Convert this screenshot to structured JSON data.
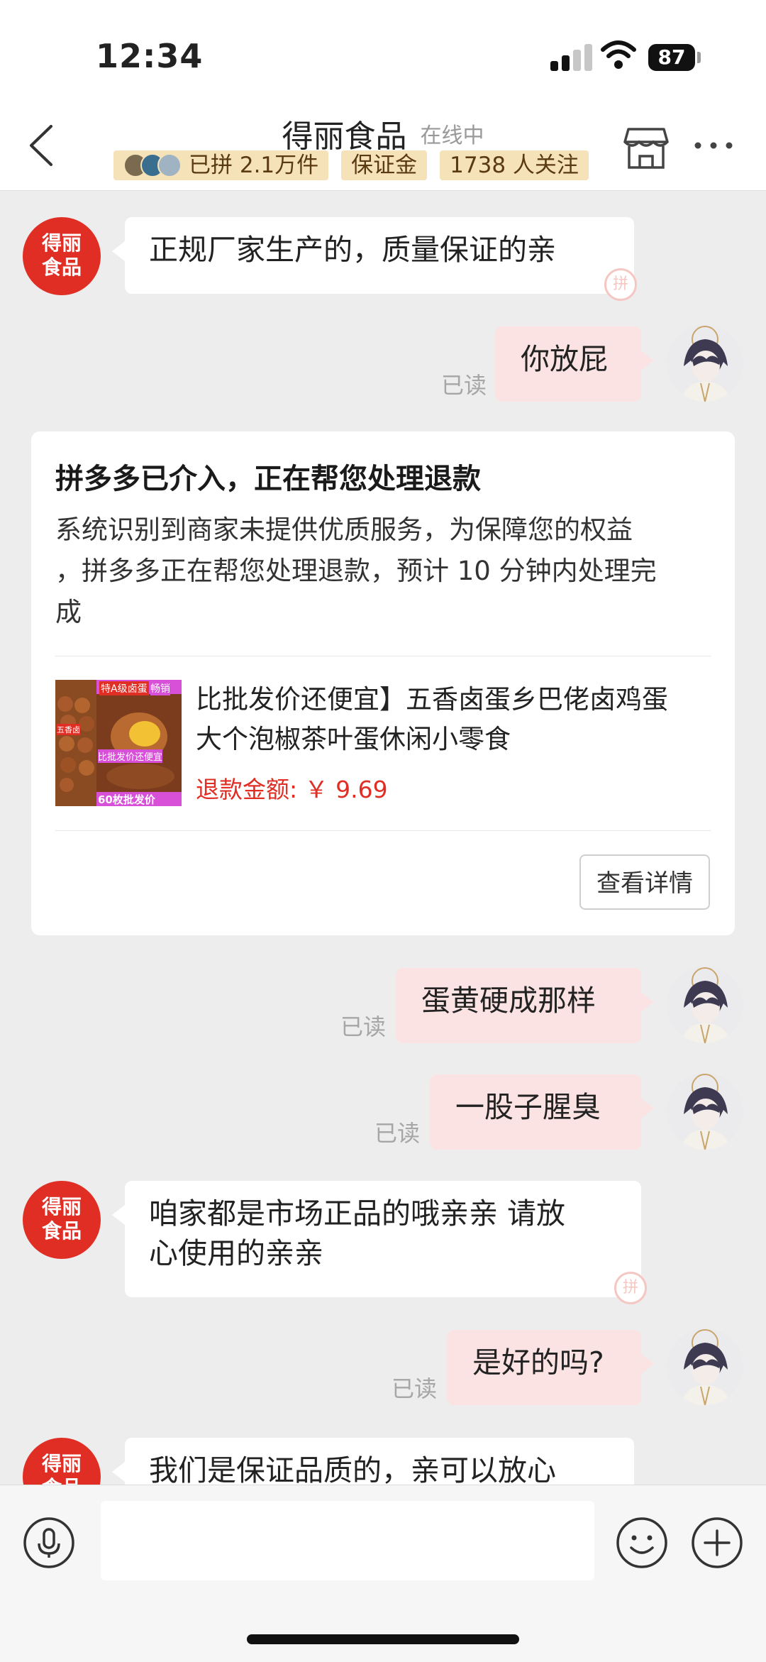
{
  "status_bar": {
    "time": "12:34",
    "battery": "87"
  },
  "header": {
    "shop_name": "得丽食品",
    "online_status": "在线中",
    "badges": [
      "已拼 2.1万件",
      "保证金",
      "1738 人关注"
    ]
  },
  "shop_avatar_text": [
    "得丽",
    "食品"
  ],
  "messages": [
    {
      "from": "shop",
      "text": "正规厂家生产的，质量保证的亲"
    },
    {
      "from": "user",
      "text": "你放屁",
      "status": "已读"
    },
    {
      "from": "user",
      "text": "蛋黄硬成那样",
      "status": "已读"
    },
    {
      "from": "user",
      "text": "一股子腥臭",
      "status": "已读"
    },
    {
      "from": "shop",
      "text_lines": [
        "咱家都是市场正品的哦亲亲 请放",
        "心使用的亲亲"
      ]
    },
    {
      "from": "user",
      "text": "是好的吗?",
      "status": "已读"
    },
    {
      "from": "shop",
      "text": "我们是保证品质的，亲可以放心"
    }
  ],
  "refund_card": {
    "title": "拼多多已介入，正在帮您处理退款",
    "description_lines": [
      "系统识别到商家未提供优质服务，为保障您的权益",
      "，拼多多正在帮您处理退款，预计 10 分钟内处理完",
      "成"
    ],
    "product_name_lines": [
      "比批发价还便宜】五香卤蛋乡巴佬卤鸡蛋",
      "大个泡椒茶叶蛋休闲小零食"
    ],
    "refund_label": "退款金额: ",
    "refund_amount": "￥ 9.69",
    "detail_button": "查看详情",
    "product_image_texts": [
      "特A级卤蛋",
      "畅销",
      "五香卤",
      "比批发价还便宜",
      "60枚批发价"
    ]
  },
  "input": {
    "placeholder": ""
  },
  "icons": {
    "back": "chevron-left-icon",
    "store": "store-icon",
    "more": "more-dots-icon",
    "mic": "microphone-icon",
    "emoji": "emoji-icon",
    "plus": "plus-icon"
  },
  "colors": {
    "brand_red": "#e02e24",
    "badge_bg": "#f6e2b9",
    "user_bubble": "#fbe3e3",
    "chat_bg": "#ededed"
  }
}
